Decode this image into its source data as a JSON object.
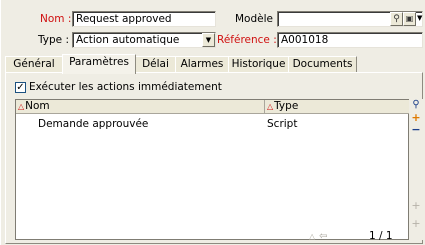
{
  "form": {
    "name_label": "Nom :",
    "name_value": "Request approved",
    "model_label": "Modèle :",
    "model_value": "",
    "type_label": "Type :",
    "type_value": "Action automatique",
    "reference_label": "Référence :",
    "reference_value": "A001018"
  },
  "tabs": [
    {
      "label": "Général"
    },
    {
      "label": "Paramètres"
    },
    {
      "label": "Délai"
    },
    {
      "label": "Alarmes"
    },
    {
      "label": "Historique"
    },
    {
      "label": "Documents"
    }
  ],
  "active_tab": "Paramètres",
  "options": {
    "execute_label": "Exécuter les actions immédiatement",
    "execute_checked": true
  },
  "list": {
    "columns": [
      {
        "label": "Nom"
      },
      {
        "label": "Type"
      }
    ],
    "rows": [
      {
        "name": "Demande approuvée",
        "type": "Script"
      }
    ]
  },
  "pager": {
    "text": "1 / 1"
  },
  "colors": {
    "required_label": "#d01010",
    "background": "#efede4"
  },
  "icons": [
    "search-icon",
    "model-picker-icon",
    "dropdown-arrow-icon",
    "add-icon",
    "remove-icon",
    "sort-arrow-icon",
    "nav-arrow-icon"
  ]
}
